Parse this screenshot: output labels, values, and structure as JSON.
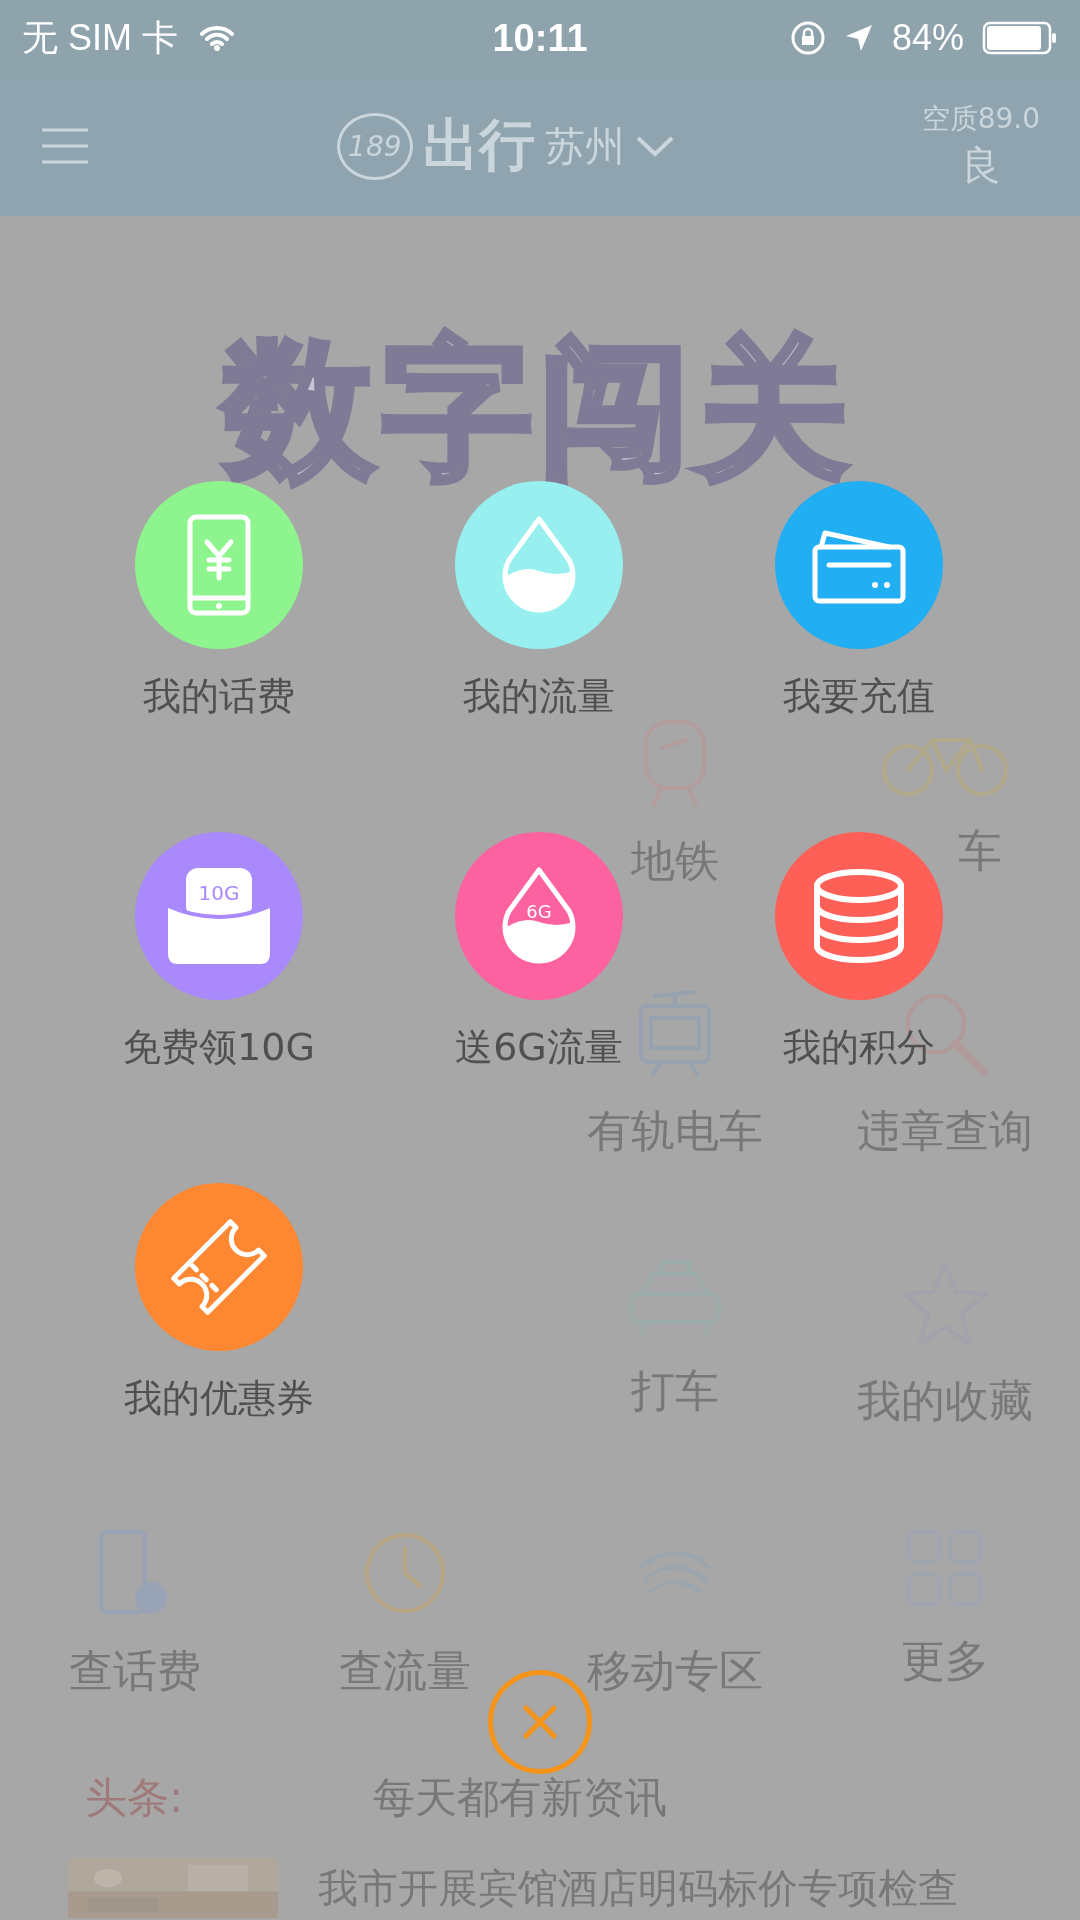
{
  "status_bar": {
    "carrier": "无 SIM 卡",
    "time": "10:11",
    "battery": "84%"
  },
  "header": {
    "logo_number": "189",
    "logo_text": "出行",
    "city": "苏州",
    "air_quality": "空质89.0",
    "air_grade": "良"
  },
  "banner": {
    "title": "数字闯关"
  },
  "services": [
    [
      {
        "kind": "blank"
      },
      {
        "kind": "blank"
      },
      {
        "kind": "metro",
        "label": "地铁"
      },
      {
        "kind": "bike",
        "label": "车",
        "partly_hidden": true
      }
    ],
    [
      {
        "kind": "blank"
      },
      {
        "kind": "blank"
      },
      {
        "kind": "tram",
        "label": "有轨电车"
      },
      {
        "kind": "search",
        "label": "违章查询"
      }
    ],
    [
      {
        "kind": "blank"
      },
      {
        "kind": "blank"
      },
      {
        "kind": "taxi",
        "label": "打车"
      },
      {
        "kind": "star",
        "label": "我的收藏"
      }
    ],
    [
      {
        "kind": "phone",
        "label": "查话费"
      },
      {
        "kind": "clock",
        "label": "查流量"
      },
      {
        "kind": "mobile",
        "label": "移动专区"
      },
      {
        "kind": "grid",
        "label": "更多"
      }
    ]
  ],
  "headline": {
    "tag": "头条:",
    "text": "每天都有新资讯"
  },
  "news": [
    {
      "title": "我市开展宾馆酒店明码标价专项检查"
    }
  ],
  "menu": [
    {
      "kind": "phone",
      "label": "我的话费",
      "color": "#8ef48e"
    },
    {
      "kind": "drop",
      "label": "我的流量",
      "color": "#97eff0"
    },
    {
      "kind": "card",
      "label": "我要充值",
      "color": "#22aef3"
    },
    {
      "kind": "envelope",
      "label": "免费领10G",
      "color": "#a989fb",
      "badge": "10G"
    },
    {
      "kind": "drop",
      "label": "送6G流量",
      "color": "#fd62a0",
      "badge": "6G"
    },
    {
      "kind": "coins",
      "label": "我的积分",
      "color": "#fe5f57"
    },
    {
      "kind": "ticket",
      "label": "我的优惠券",
      "color": "#fe8732"
    }
  ]
}
